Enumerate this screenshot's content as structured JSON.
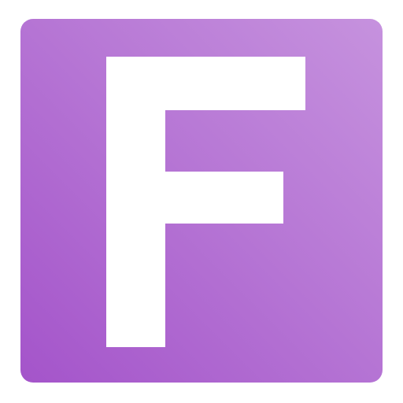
{
  "icon": {
    "letter": "F",
    "icon_name": "letter-f-app-icon",
    "colors": {
      "gradient_dark": "#a454ca",
      "gradient_mid": "#b574d4",
      "gradient_light": "#c692de",
      "glyph": "#ffffff",
      "page_background": "#ffffff"
    }
  }
}
